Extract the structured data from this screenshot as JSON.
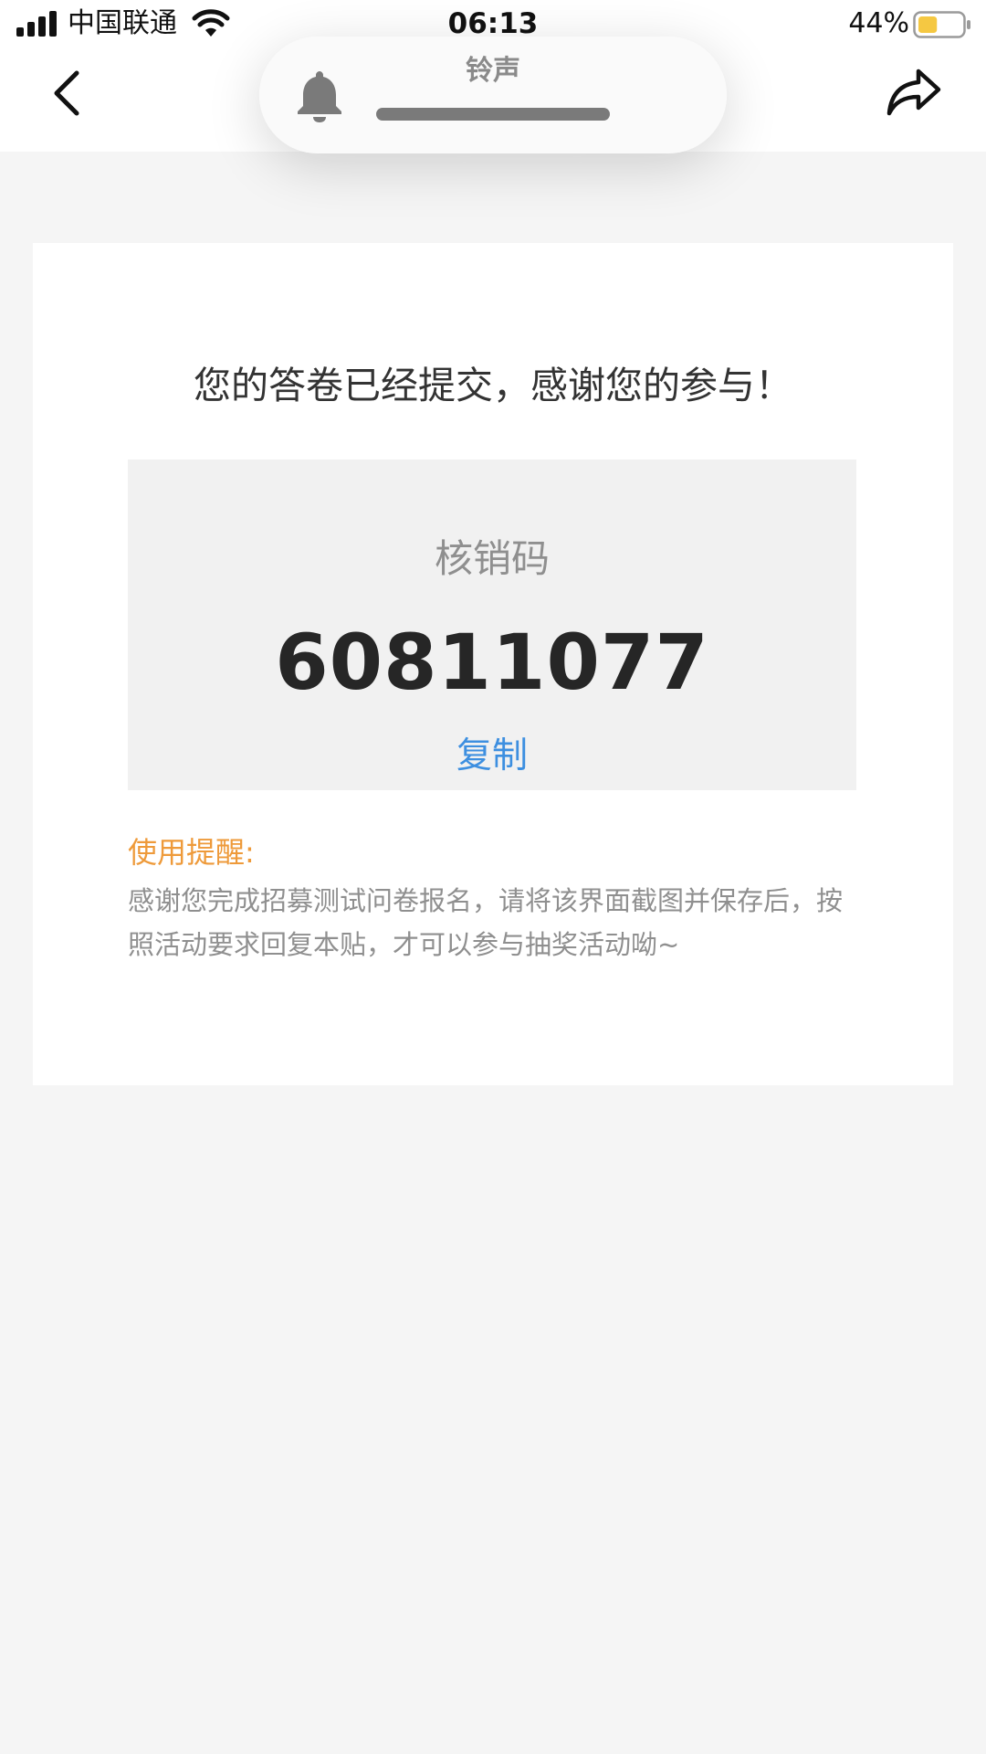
{
  "status_bar": {
    "carrier": "中国联通",
    "time": "06:13",
    "battery_percent": "44%",
    "battery_level": 0.44,
    "battery_color": "#f5c842",
    "icons": [
      "signal-icon",
      "wifi-icon",
      "battery-icon"
    ]
  },
  "nav": {
    "back_icon": "chevron-left-icon",
    "share_icon": "share-arrow-icon"
  },
  "ringer_hud": {
    "label": "铃声",
    "icon": "bell-icon"
  },
  "result": {
    "title": "您的答卷已经提交，感谢您的参与！",
    "code_label": "核销码",
    "code_value": "60811077",
    "copy_label": "复制",
    "reminder_title": "使用提醒:",
    "reminder_body": "感谢您完成招募测试问卷报名，请将该界面截图并保存后，按照活动要求回复本贴，才可以参与抽奖活动呦~"
  },
  "colors": {
    "page_background": "#f5f5f5",
    "accent_link": "#3d8fe0",
    "reminder_orange": "#ee9a3a",
    "code_box_background": "#f1f1f1"
  }
}
